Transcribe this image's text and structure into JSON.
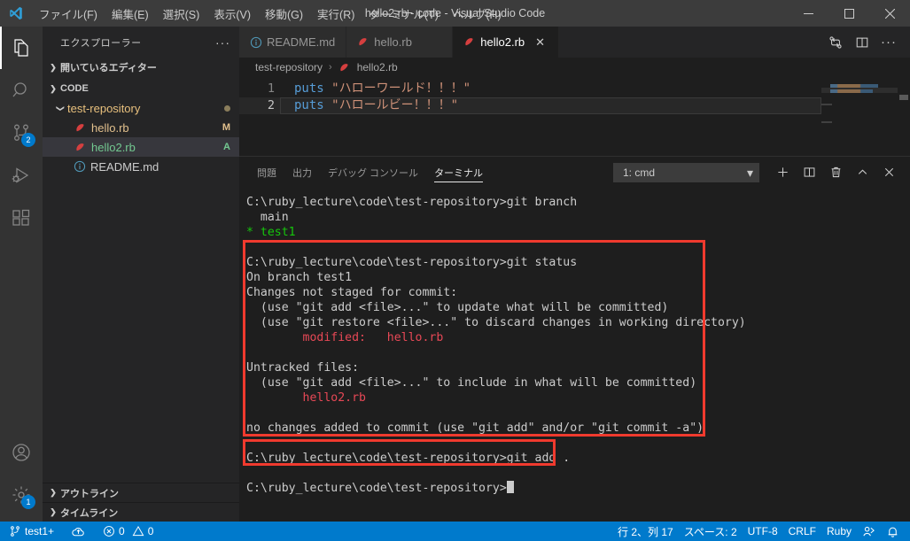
{
  "titlebar": {
    "title": "hello2.rb - code - Visual Studio Code",
    "menus": [
      "ファイル(F)",
      "編集(E)",
      "選択(S)",
      "表示(V)",
      "移動(G)",
      "実行(R)",
      "ターミナル(T)",
      "ヘルプ(H)"
    ],
    "minimize": "—",
    "maximize": "□",
    "close": "✕"
  },
  "activitybar": {
    "items": [
      {
        "name": "explorer",
        "active": true,
        "badge": null
      },
      {
        "name": "search",
        "active": false,
        "badge": null
      },
      {
        "name": "source-control",
        "active": false,
        "badge": "2"
      },
      {
        "name": "run-and-debug",
        "active": false,
        "badge": null
      },
      {
        "name": "extensions",
        "active": false,
        "badge": null
      }
    ],
    "accounts_badge": null,
    "settings_badge": "1"
  },
  "sidebar": {
    "title": "エクスプローラー",
    "more_actions": "···",
    "open_editors": "開いているエディター",
    "folder": "CODE",
    "tree": [
      {
        "label": "test-repository",
        "kind": "folder",
        "indent": 1,
        "status": "",
        "selected": false,
        "dot": true
      },
      {
        "label": "hello.rb",
        "kind": "ruby",
        "indent": 2,
        "status": "M",
        "status_color": "#e2c08d",
        "selected": false,
        "dot": false
      },
      {
        "label": "hello2.rb",
        "kind": "ruby",
        "indent": 2,
        "status": "A",
        "status_color": "#73c991",
        "selected": true,
        "label_color": "#73c991",
        "dot": false
      },
      {
        "label": "README.md",
        "kind": "markdown",
        "indent": 2,
        "status": "",
        "selected": false,
        "dot": false
      }
    ],
    "bottom_sections": [
      "アウトライン",
      "タイムライン"
    ]
  },
  "editor": {
    "tabs": [
      {
        "label": "README.md",
        "icon": "markdown-icon",
        "active": false,
        "closable": false
      },
      {
        "label": "hello.rb",
        "icon": "ruby-icon",
        "active": false,
        "closable": false
      },
      {
        "label": "hello2.rb",
        "icon": "ruby-icon",
        "active": true,
        "closable": true
      }
    ],
    "tab_close": "✕",
    "actions": [
      "split-editor-compare-icon",
      "split-editor-icon",
      "more-actions-icon"
    ],
    "breadcrumb": [
      "test-repository",
      "hello2.rb"
    ],
    "breadcrumb_separator": "›",
    "lines": [
      {
        "number": "1",
        "keyword": "puts",
        "string": "\"ハローワールド！！！\"",
        "current": false
      },
      {
        "number": "2",
        "keyword": "puts",
        "string": "\"ハロールビー！！！\"",
        "current": true
      }
    ]
  },
  "panel": {
    "tabs": [
      {
        "label": "問題",
        "active": false
      },
      {
        "label": "出力",
        "active": false
      },
      {
        "label": "デバッグ コンソール",
        "active": false
      },
      {
        "label": "ターミナル",
        "active": true
      }
    ],
    "terminal_selector": "1: cmd",
    "selector_chevron": "⌄",
    "actions": [
      "new-terminal-icon",
      "split-terminal-icon",
      "kill-terminal-icon",
      "maximize-panel-icon",
      "close-panel-icon"
    ],
    "terminal_lines": [
      {
        "text": "C:\\ruby_lecture\\code\\test-repository>git branch",
        "color": "default"
      },
      {
        "text": "  main",
        "color": "default"
      },
      {
        "text": "* test1",
        "color": "green"
      },
      {
        "text": "",
        "color": "default"
      },
      {
        "text": "C:\\ruby_lecture\\code\\test-repository>git status",
        "color": "default"
      },
      {
        "text": "On branch test1",
        "color": "default"
      },
      {
        "text": "Changes not staged for commit:",
        "color": "default"
      },
      {
        "text": "  (use \"git add <file>...\" to update what will be committed)",
        "color": "default"
      },
      {
        "text": "  (use \"git restore <file>...\" to discard changes in working directory)",
        "color": "default"
      },
      {
        "text": "        modified:   hello.rb",
        "color": "red"
      },
      {
        "text": "",
        "color": "default"
      },
      {
        "text": "Untracked files:",
        "color": "default"
      },
      {
        "text": "  (use \"git add <file>...\" to include in what will be committed)",
        "color": "default"
      },
      {
        "text": "        hello2.rb",
        "color": "red"
      },
      {
        "text": "",
        "color": "default"
      },
      {
        "text": "no changes added to commit (use \"git add\" and/or \"git commit -a\")",
        "color": "default"
      },
      {
        "text": "",
        "color": "default"
      },
      {
        "text": "C:\\ruby_lecture\\code\\test-repository>git add .",
        "color": "default"
      },
      {
        "text": "",
        "color": "default"
      },
      {
        "text": "C:\\ruby_lecture\\code\\test-repository>",
        "color": "default",
        "cursor": true
      }
    ],
    "highlight_color": "#f03a2e"
  },
  "statusbar": {
    "branch": "test1+",
    "sync_icon": "cloud-upload-icon",
    "errors": "0",
    "warnings": "0",
    "position": "行 2、列 17",
    "indent": "スペース: 2",
    "encoding": "UTF-8",
    "eol": "CRLF",
    "language": "Ruby",
    "feedback_icon": "feedback-icon",
    "bell_icon": "bell-icon",
    "background": "#007acc"
  }
}
